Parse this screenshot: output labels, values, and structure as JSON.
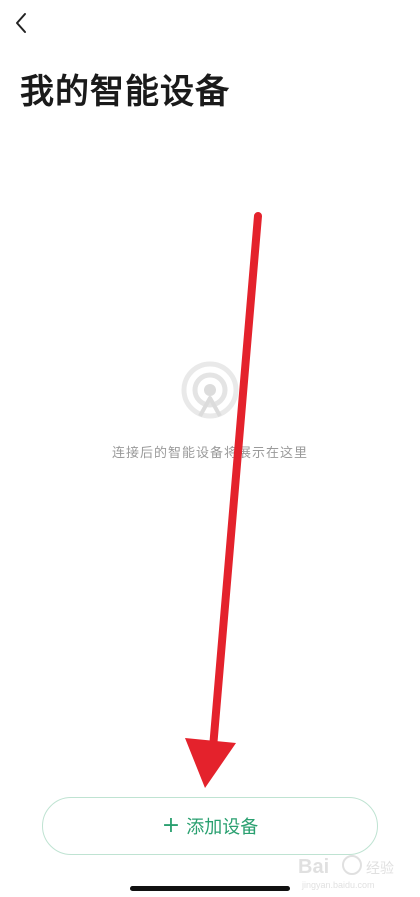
{
  "header": {
    "back_icon": "chevron-left-icon",
    "title": "我的智能设备"
  },
  "empty_state": {
    "icon": "signal-broadcast-icon",
    "message": "连接后的智能设备将展示在这里"
  },
  "footer": {
    "add_button": {
      "icon": "plus-icon",
      "label": "添加设备"
    }
  },
  "colors": {
    "accent": "#2aa070",
    "button_border": "#bfe3d2",
    "annotation_arrow": "#e4222c",
    "muted_text": "#9a9a9a"
  },
  "watermark": {
    "text": "Bai",
    "sub_text": "jingyan.baidu.com"
  }
}
